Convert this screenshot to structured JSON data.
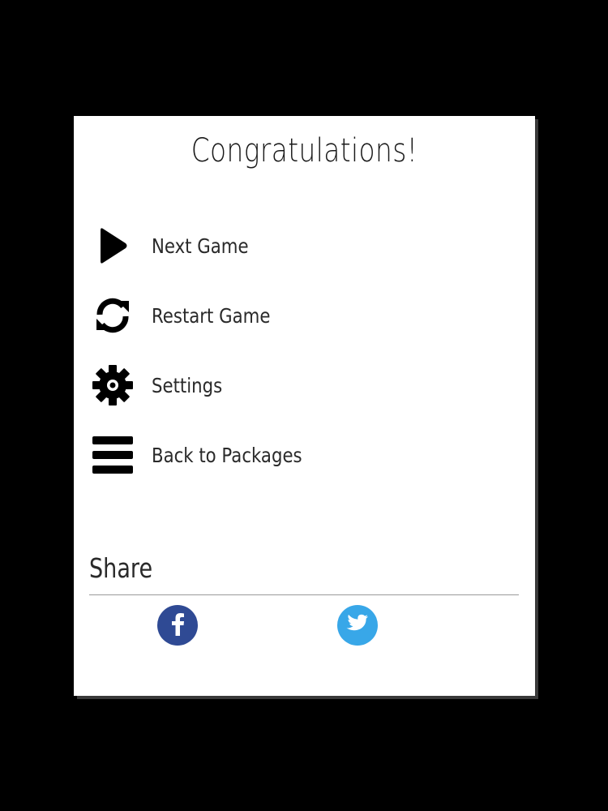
{
  "dialog": {
    "title": "Congratulations!"
  },
  "menu": {
    "items": [
      {
        "label": "Next Game",
        "icon": "play-icon"
      },
      {
        "label": "Restart Game",
        "icon": "refresh-icon"
      },
      {
        "label": "Settings",
        "icon": "gear-icon"
      },
      {
        "label": "Back to Packages",
        "icon": "menu-icon"
      }
    ]
  },
  "share": {
    "title": "Share",
    "networks": [
      {
        "icon": "facebook-icon",
        "color": "#2f4a94"
      },
      {
        "icon": "twitter-icon",
        "color": "#38a7e8"
      }
    ]
  },
  "colors": {
    "background": "#000000",
    "dialog": "#ffffff",
    "icon": "#000000"
  }
}
